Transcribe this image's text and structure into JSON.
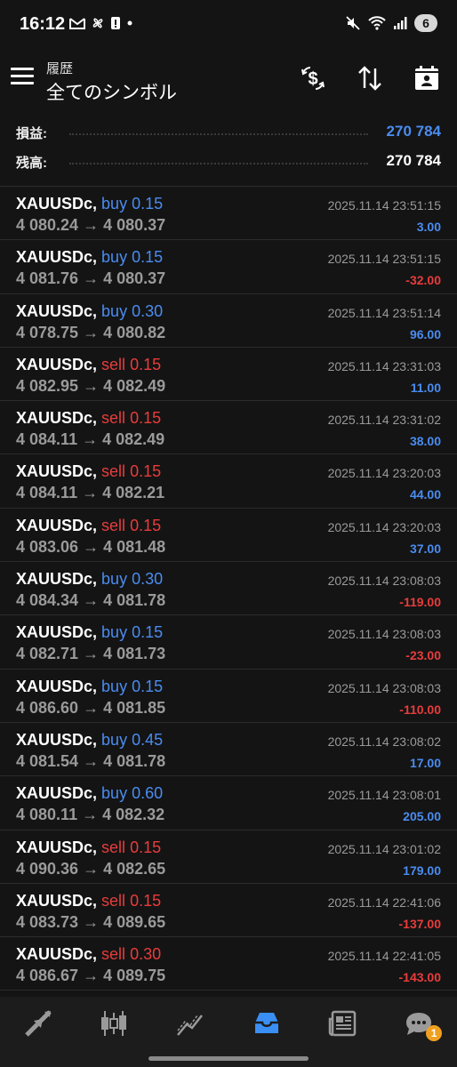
{
  "status": {
    "time": "16:12",
    "battery": "6"
  },
  "header": {
    "subtitle": "履歴",
    "title": "全てのシンボル"
  },
  "summary": {
    "profit_label": "損益:",
    "profit_value": "270 784",
    "balance_label": "残高:",
    "balance_value": "270 784"
  },
  "trades": [
    {
      "symbol": "XAUUSDc,",
      "side": "buy",
      "volume": "0.15",
      "open": "4 080.24",
      "close": "4 080.37",
      "time": "2025.11.14 23:51:15",
      "profit": "3.00"
    },
    {
      "symbol": "XAUUSDc,",
      "side": "buy",
      "volume": "0.15",
      "open": "4 081.76",
      "close": "4 080.37",
      "time": "2025.11.14 23:51:15",
      "profit": "-32.00"
    },
    {
      "symbol": "XAUUSDc,",
      "side": "buy",
      "volume": "0.30",
      "open": "4 078.75",
      "close": "4 080.82",
      "time": "2025.11.14 23:51:14",
      "profit": "96.00"
    },
    {
      "symbol": "XAUUSDc,",
      "side": "sell",
      "volume": "0.15",
      "open": "4 082.95",
      "close": "4 082.49",
      "time": "2025.11.14 23:31:03",
      "profit": "11.00"
    },
    {
      "symbol": "XAUUSDc,",
      "side": "sell",
      "volume": "0.15",
      "open": "4 084.11",
      "close": "4 082.49",
      "time": "2025.11.14 23:31:02",
      "profit": "38.00"
    },
    {
      "symbol": "XAUUSDc,",
      "side": "sell",
      "volume": "0.15",
      "open": "4 084.11",
      "close": "4 082.21",
      "time": "2025.11.14 23:20:03",
      "profit": "44.00"
    },
    {
      "symbol": "XAUUSDc,",
      "side": "sell",
      "volume": "0.15",
      "open": "4 083.06",
      "close": "4 081.48",
      "time": "2025.11.14 23:20:03",
      "profit": "37.00"
    },
    {
      "symbol": "XAUUSDc,",
      "side": "buy",
      "volume": "0.30",
      "open": "4 084.34",
      "close": "4 081.78",
      "time": "2025.11.14 23:08:03",
      "profit": "-119.00"
    },
    {
      "symbol": "XAUUSDc,",
      "side": "buy",
      "volume": "0.15",
      "open": "4 082.71",
      "close": "4 081.73",
      "time": "2025.11.14 23:08:03",
      "profit": "-23.00"
    },
    {
      "symbol": "XAUUSDc,",
      "side": "buy",
      "volume": "0.15",
      "open": "4 086.60",
      "close": "4 081.85",
      "time": "2025.11.14 23:08:03",
      "profit": "-110.00"
    },
    {
      "symbol": "XAUUSDc,",
      "side": "buy",
      "volume": "0.45",
      "open": "4 081.54",
      "close": "4 081.78",
      "time": "2025.11.14 23:08:02",
      "profit": "17.00"
    },
    {
      "symbol": "XAUUSDc,",
      "side": "buy",
      "volume": "0.60",
      "open": "4 080.11",
      "close": "4 082.32",
      "time": "2025.11.14 23:08:01",
      "profit": "205.00"
    },
    {
      "symbol": "XAUUSDc,",
      "side": "sell",
      "volume": "0.15",
      "open": "4 090.36",
      "close": "4 082.65",
      "time": "2025.11.14 23:01:02",
      "profit": "179.00"
    },
    {
      "symbol": "XAUUSDc,",
      "side": "sell",
      "volume": "0.15",
      "open": "4 083.73",
      "close": "4 089.65",
      "time": "2025.11.14 22:41:06",
      "profit": "-137.00"
    },
    {
      "symbol": "XAUUSDc,",
      "side": "sell",
      "volume": "0.30",
      "open": "4 086.67",
      "close": "4 089.75",
      "time": "2025.11.14 22:41:05",
      "profit": "-143.00"
    }
  ],
  "nav": {
    "items": [
      {
        "icon": "trade-arrows-icon",
        "active": false
      },
      {
        "icon": "candlestick-icon",
        "active": false
      },
      {
        "icon": "chart-line-icon",
        "active": false
      },
      {
        "icon": "history-inbox-icon",
        "active": true
      },
      {
        "icon": "news-icon",
        "active": false
      },
      {
        "icon": "chat-icon",
        "active": false,
        "badge": "1"
      }
    ]
  },
  "colors": {
    "buy": "#4a8cf0",
    "sell": "#e83c3c",
    "active_nav": "#3a8ff5",
    "background": "#141414"
  }
}
